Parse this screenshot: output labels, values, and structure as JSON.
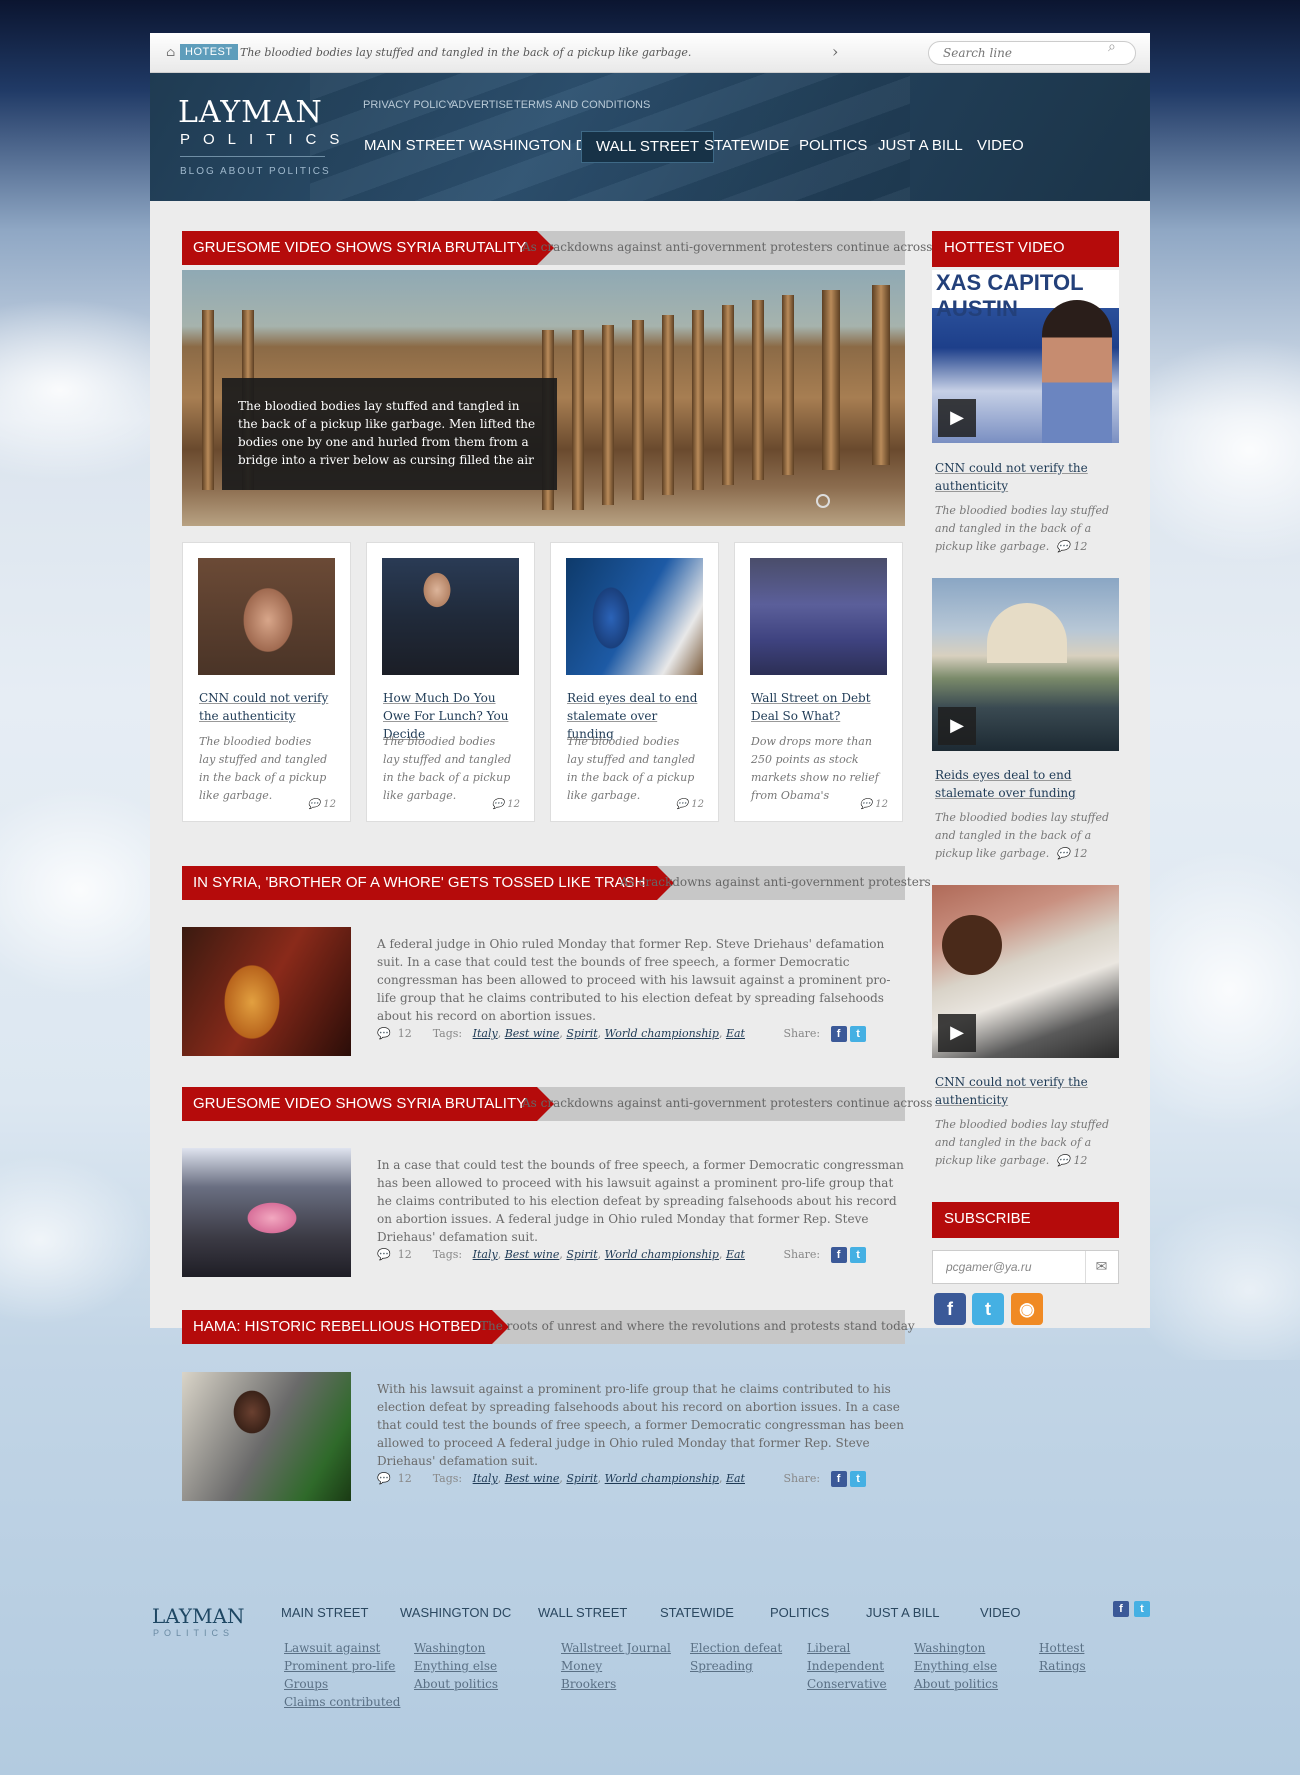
{
  "topbar": {
    "hot_label": "HOTEST",
    "ticker": "The bloodied bodies lay stuffed and tangled in the back of a pickup like garbage.",
    "search_placeholder": "Search line"
  },
  "header": {
    "logo_main": "LAYMAN",
    "logo_sub": "POLITICS",
    "logo_tag": "BLOG ABOUT POLITICS",
    "sublinks": [
      "PRIVACY POLICY",
      "ADVERTISE",
      "TERMS AND CONDITIONS"
    ],
    "nav": [
      "MAIN STREET",
      "WASHINGTON DC",
      "WALL STREET",
      "STATEWIDE",
      "POLITICS",
      "JUST A BILL",
      "VIDEO"
    ]
  },
  "featured": {
    "headline": "GRUESOME VIDEO SHOWS SYRIA BRUTALITY",
    "subline": "As crackdowns against anti-government protesters continue across",
    "caption": "The bloodied bodies lay stuffed and tangled in the back of a pickup like garbage. Men lifted the bodies one by one and hurled from them from a bridge into a river below as cursing filled the air"
  },
  "cards": [
    {
      "title": "CNN could not verify the authenticity",
      "text": "The bloodied bodies lay stuffed and tangled in the back of a pickup like garbage.",
      "comments": "12"
    },
    {
      "title": "How Much Do You Owe For Lunch? You Decide",
      "text": "The bloodied bodies lay stuffed and tangled in the back of a pickup like garbage.",
      "comments": "12"
    },
    {
      "title": "Reid eyes deal to end stalemate over funding",
      "text": "The bloodied bodies lay stuffed and tangled in the back of a pickup like garbage.",
      "comments": "12"
    },
    {
      "title": "Wall Street on Debt Deal So What?",
      "text": "Dow drops more than 250 points as stock markets show no relief from Obama's",
      "comments": "12"
    }
  ],
  "articles": [
    {
      "headline": "IN SYRIA, 'BROTHER OF A WHORE' GETS TOSSED LIKE TRASH",
      "subline": "As crackdowns against anti-government protesters",
      "text": "A federal judge in Ohio ruled Monday that former Rep. Steve Driehaus' defamation suit. In a case that could test the bounds of free speech, a former Democratic congressman has been allowed to proceed with his lawsuit against a prominent pro-life group that he claims contributed to his election defeat by spreading falsehoods about his record on abortion issues.",
      "comments": "12"
    },
    {
      "headline": "GRUESOME VIDEO SHOWS SYRIA BRUTALITY",
      "subline": "As crackdowns against anti-government protesters continue across",
      "text": "In a case that could test the bounds of free speech, a former Democratic congressman has been allowed to proceed with his lawsuit against a prominent pro-life group that he claims contributed to his election defeat by spreading falsehoods about his record on abortion issues. A federal judge in Ohio ruled Monday that former Rep. Steve Driehaus' defamation suit.",
      "comments": "12"
    },
    {
      "headline": "HAMA: HISTORIC REBELLIOUS HOTBED",
      "subline": "The roots of unrest and where the revolutions and protests stand today",
      "text": "With his lawsuit against a prominent pro-life group that he claims contributed to his election defeat by spreading falsehoods about his record on abortion issues.  In a case that could test the bounds of free speech, a former Democratic congressman has been allowed to proceed A federal judge in Ohio ruled Monday that former Rep. Steve Driehaus' defamation suit.",
      "comments": "12"
    }
  ],
  "meta": {
    "tags_label": "Tags:",
    "tags": [
      "Italy",
      "Best wine",
      "Spirit",
      "World championship",
      "Eat"
    ],
    "share_label": "Share:"
  },
  "sidebar": {
    "hottest_label": "HOTTEST VIDEO",
    "video_image_text": "XAS CAPITOL AUSTIN",
    "videos": [
      {
        "title": "CNN could not verify the authenticity",
        "text": "The bloodied bodies lay stuffed and tangled in the back of a pickup like garbage.",
        "comments": "12"
      },
      {
        "title": "Reids eyes deal to end stalemate over funding",
        "text": "The bloodied bodies lay stuffed and tangled in the back of a pickup like garbage.",
        "comments": "12"
      },
      {
        "title": "CNN could not verify the authenticity",
        "text": "The bloodied bodies lay stuffed and tangled in the back of a pickup like garbage.",
        "comments": "12"
      }
    ],
    "subscribe_label": "SUBSCRIBE",
    "subscribe_value": "pcgamer@ya.ru"
  },
  "footer": {
    "logo_main": "LAYMAN",
    "logo_sub": "POLITICS",
    "nav": [
      "MAIN STREET",
      "WASHINGTON DC",
      "WALL STREET",
      "STATEWIDE",
      "POLITICS",
      "JUST A BILL",
      "VIDEO"
    ],
    "columns": [
      [
        "Lawsuit against",
        "Prominent pro-life",
        "Groups",
        "Claims contributed"
      ],
      [
        "Washington",
        "Enything else",
        "About politics"
      ],
      [
        "Wallstreet Journal",
        "Money",
        "Brookers"
      ],
      [
        "Election defeat",
        "Spreading"
      ],
      [
        "Liberal",
        "Independent",
        "Conservative"
      ],
      [
        "Washington",
        "Enything else",
        "About politics"
      ],
      [
        "Hottest",
        "Ratings"
      ]
    ]
  },
  "colors": {
    "accent": "#b50b0b",
    "header": "#213e57",
    "link": "#1e3a55"
  }
}
